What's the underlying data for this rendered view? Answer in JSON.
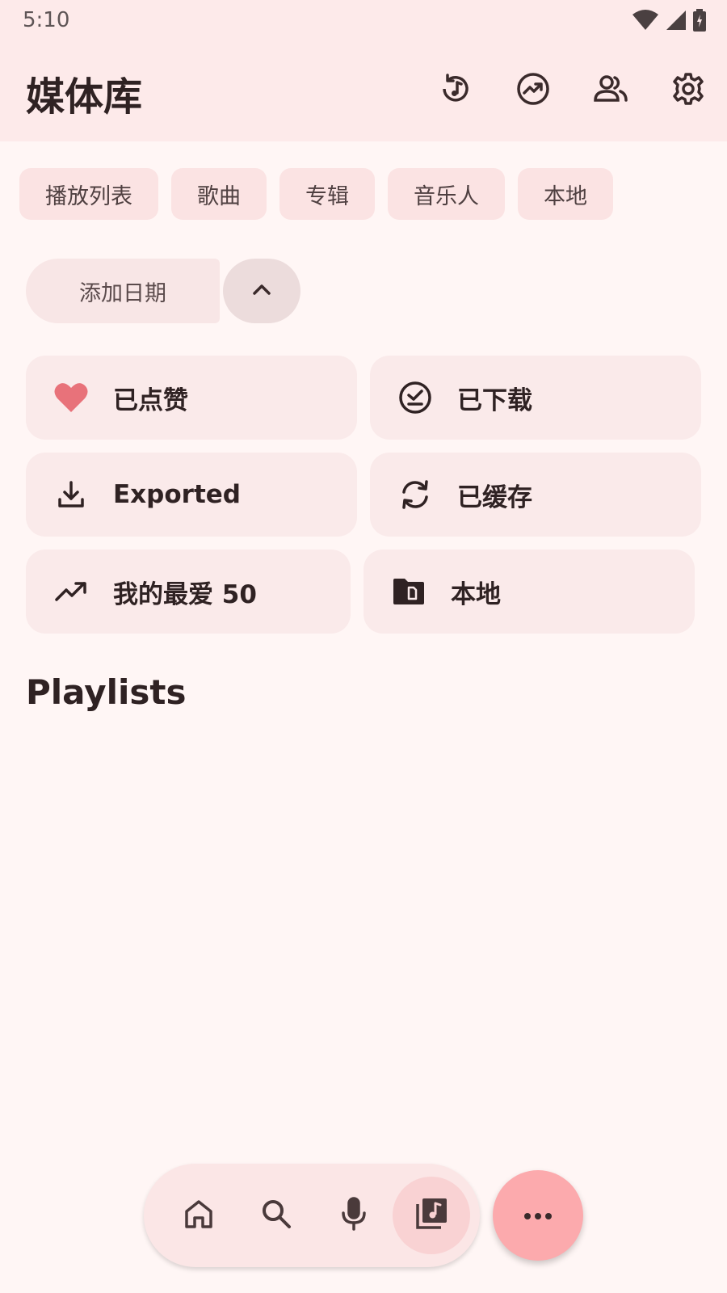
{
  "status": {
    "time": "5:10",
    "icons": [
      "wifi-icon",
      "signal-icon",
      "battery-icon"
    ]
  },
  "header": {
    "title": "媒体库",
    "actions": [
      "history-icon",
      "trending-icon",
      "accounts-icon",
      "settings-icon"
    ]
  },
  "chips": [
    "播放列表",
    "歌曲",
    "专辑",
    "音乐人",
    "本地"
  ],
  "sort": {
    "label": "添加日期",
    "toggle_icon": "chevron-up-icon"
  },
  "cards": [
    {
      "label": "已点赞",
      "icon": "heart-icon"
    },
    {
      "label": "已下载",
      "icon": "downloaded-check-icon"
    },
    {
      "label": "Exported",
      "icon": "download-icon"
    },
    {
      "label": "已缓存",
      "icon": "sync-icon"
    },
    {
      "label": "我的最爱 50",
      "icon": "trending-up-icon"
    },
    {
      "label": "本地",
      "icon": "folder-icon"
    }
  ],
  "section": {
    "title": "Playlists"
  },
  "nav": {
    "items": [
      "home-icon",
      "search-icon",
      "mic-icon",
      "library-music-icon"
    ],
    "active_index": 3
  },
  "fab": {
    "icon": "more-horiz-icon"
  },
  "colors": {
    "background": "#fff6f5",
    "topbar": "#fdeaea",
    "chip": "#fbe3e3",
    "card": "#faeaea",
    "heart": "#e8727a",
    "fab": "#fcaaad",
    "text_dark": "#2f2223"
  }
}
